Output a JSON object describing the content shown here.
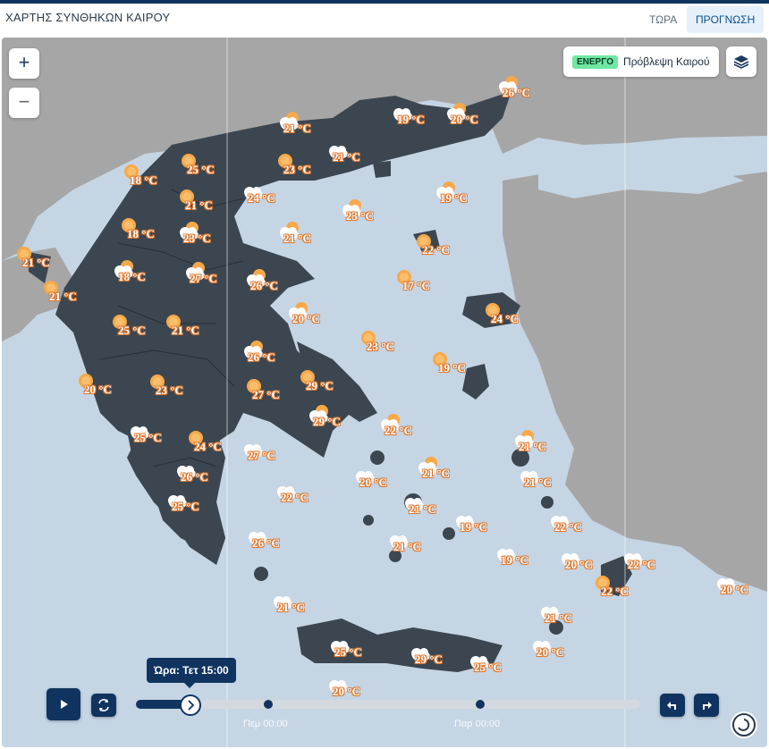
{
  "header": {
    "title": "ΧΑΡΤΗΣ ΣΥΝΘΗΚΩΝ ΚΑΙΡΟΥ",
    "tabs": [
      {
        "label": "ΤΩΡΑ",
        "active": false
      },
      {
        "label": "ΠΡΟΓΝΩΣΗ",
        "active": true
      }
    ]
  },
  "map_controls": {
    "zoom_in": "+",
    "zoom_out": "−",
    "status_badge": "ΕΝΕΡΓΟ",
    "layer_name": "Πρόβλεψη Καιρού",
    "layers_icon": "layers-icon"
  },
  "colors": {
    "sea": "#c5d5e4",
    "land_greece": "#3b4650",
    "land_other": "#a6a6a6",
    "accent": "#10345f",
    "temp_outline": "#e0762a"
  },
  "markers": [
    {
      "temp": "26 °C",
      "icon": "sun-cloud"
    },
    {
      "temp": "19 °C",
      "icon": "cloud"
    },
    {
      "temp": "20 °C",
      "icon": "sun-cloud"
    },
    {
      "temp": "21 °C",
      "icon": "sun-cloud"
    },
    {
      "temp": "25 °C",
      "icon": "sun"
    },
    {
      "temp": "23 °C",
      "icon": "sun"
    },
    {
      "temp": "21 °C",
      "icon": "cloud"
    },
    {
      "temp": "18 °C",
      "icon": "sun"
    },
    {
      "temp": "21 °C",
      "icon": "sun"
    },
    {
      "temp": "24 °C",
      "icon": "cloud"
    },
    {
      "temp": "19 °C",
      "icon": "sun-cloud"
    },
    {
      "temp": "23 °C",
      "icon": "sun-cloud"
    },
    {
      "temp": "18 °C",
      "icon": "sun"
    },
    {
      "temp": "23 °C",
      "icon": "sun-cloud"
    },
    {
      "temp": "21 °C",
      "icon": "sun-cloud"
    },
    {
      "temp": "21 °C",
      "icon": "sun"
    },
    {
      "temp": "22 °C",
      "icon": "sun"
    },
    {
      "temp": "18 °C",
      "icon": "sun-cloud"
    },
    {
      "temp": "27 °C",
      "icon": "sun-cloud"
    },
    {
      "temp": "26 °C",
      "icon": "sun-cloud"
    },
    {
      "temp": "17 °C",
      "icon": "sun"
    },
    {
      "temp": "21 °C",
      "icon": "sun"
    },
    {
      "temp": "20 °C",
      "icon": "sun-cloud"
    },
    {
      "temp": "24 °C",
      "icon": "sun"
    },
    {
      "temp": "25 °C",
      "icon": "sun"
    },
    {
      "temp": "21 °C",
      "icon": "sun"
    },
    {
      "temp": "23 °C",
      "icon": "sun"
    },
    {
      "temp": "26 °C",
      "icon": "sun-cloud"
    },
    {
      "temp": "19 °C",
      "icon": "sun"
    },
    {
      "temp": "20 °C",
      "icon": "sun"
    },
    {
      "temp": "23 °C",
      "icon": "sun"
    },
    {
      "temp": "27 °C",
      "icon": "sun"
    },
    {
      "temp": "29 °C",
      "icon": "sun"
    },
    {
      "temp": "29 °C",
      "icon": "sun-cloud"
    },
    {
      "temp": "22 °C",
      "icon": "sun-cloud"
    },
    {
      "temp": "25 °C",
      "icon": "cloud"
    },
    {
      "temp": "24 °C",
      "icon": "sun"
    },
    {
      "temp": "27 °C",
      "icon": "cloud"
    },
    {
      "temp": "21 °C",
      "icon": "sun-cloud"
    },
    {
      "temp": "26 °C",
      "icon": "cloud"
    },
    {
      "temp": "20 °C",
      "icon": "cloud"
    },
    {
      "temp": "21 °C",
      "icon": "sun-cloud"
    },
    {
      "temp": "21 °C",
      "icon": "cloud"
    },
    {
      "temp": "22 °C",
      "icon": "cloud"
    },
    {
      "temp": "25 °C",
      "icon": "cloud"
    },
    {
      "temp": "21 °C",
      "icon": "cloud"
    },
    {
      "temp": "19 °C",
      "icon": "cloud"
    },
    {
      "temp": "22 °C",
      "icon": "cloud"
    },
    {
      "temp": "21 °C",
      "icon": "cloud"
    },
    {
      "temp": "19 °C",
      "icon": "cloud"
    },
    {
      "temp": "26 °C",
      "icon": "cloud"
    },
    {
      "temp": "20 °C",
      "icon": "cloud"
    },
    {
      "temp": "22 °C",
      "icon": "cloud"
    },
    {
      "temp": "22 °C",
      "icon": "sun"
    },
    {
      "temp": "20 °C",
      "icon": "cloud"
    },
    {
      "temp": "21 °C",
      "icon": "cloud"
    },
    {
      "temp": "21 °C",
      "icon": "cloud"
    },
    {
      "temp": "20 °C",
      "icon": "cloud"
    },
    {
      "temp": "25 °C",
      "icon": "cloud"
    },
    {
      "temp": "29 °C",
      "icon": "cloud"
    },
    {
      "temp": "25 °C",
      "icon": "cloud"
    },
    {
      "temp": "20 °C",
      "icon": "cloud"
    }
  ],
  "timeline": {
    "tooltip": "Ώρα: Τετ 15:00",
    "progress": 0.1,
    "ticks": [
      "Πεμ 00:00",
      "Παρ 00:00"
    ],
    "play_icon": "play-icon",
    "loop_icon": "loop-icon",
    "prev_icon": "step-back-icon",
    "next_icon": "step-forward-icon"
  }
}
